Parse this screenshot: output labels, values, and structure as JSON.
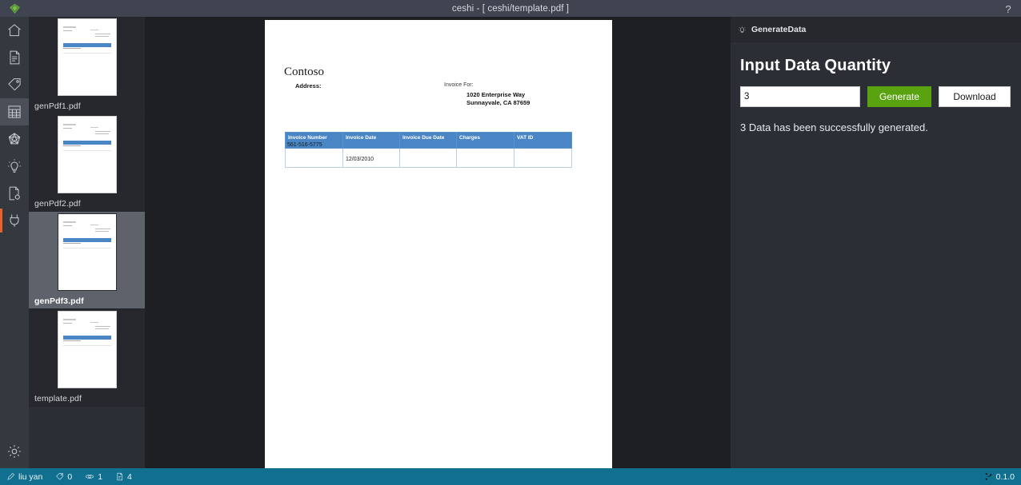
{
  "titlebar": {
    "title": "ceshi - [ ceshi/template.pdf ]",
    "logo_icon": "gem-logo-icon",
    "help_icon": "help-question-icon",
    "help_label": "?"
  },
  "sidebar": {
    "items": [
      {
        "icon": "home-icon",
        "name": "home"
      },
      {
        "icon": "document-icon",
        "name": "document"
      },
      {
        "icon": "tag-icon",
        "name": "tag"
      },
      {
        "icon": "table-grid-icon",
        "name": "table",
        "active": true
      },
      {
        "icon": "network-graph-icon",
        "name": "network"
      },
      {
        "icon": "lightbulb-icon",
        "name": "ideas"
      },
      {
        "icon": "document-settings-icon",
        "name": "document-settings"
      },
      {
        "icon": "plug-icon",
        "name": "plugins",
        "accent": true
      }
    ],
    "bottom_icon": "gear-icon"
  },
  "filelist": {
    "files": [
      {
        "label": "genPdf1.pdf",
        "selected": false
      },
      {
        "label": "genPdf2.pdf",
        "selected": false
      },
      {
        "label": "genPdf3.pdf",
        "selected": true
      },
      {
        "label": "template.pdf",
        "selected": false
      }
    ]
  },
  "document": {
    "brand": "Contoso",
    "address_label": "Address:",
    "invoice_for_label": "Invoice For:",
    "address_line1": "1020 Enterprise Way",
    "address_line2": "Sunnayvale, CA 87659",
    "table": {
      "headers": [
        "Invoice Number",
        "Invoice Date",
        "Invoice Due Date",
        "Charges",
        "VAT ID"
      ],
      "rows": [
        [
          "561-516-5775",
          "12/03/2010",
          "",
          "",
          ""
        ]
      ]
    }
  },
  "right_panel": {
    "header_icon": "lightbulb-icon",
    "header_title": "GenerateData",
    "heading": "Input Data Quantity",
    "quantity_value": "3",
    "quantity_placeholder": "",
    "generate_label": "Generate",
    "download_label": "Download",
    "status_message": "3 Data has been successfully generated.",
    "accent_green": "#5aa310"
  },
  "statusbar": {
    "user_icon": "pen-icon",
    "user": "liu yan",
    "tag_icon": "tag-icon",
    "tag_count": "0",
    "eye_icon": "eye-icon",
    "eye_count": "1",
    "file_icon": "file-icon",
    "file_count": "4",
    "branch_icon": "branch-icon",
    "version": "0.1.0",
    "background": "#11708f"
  }
}
